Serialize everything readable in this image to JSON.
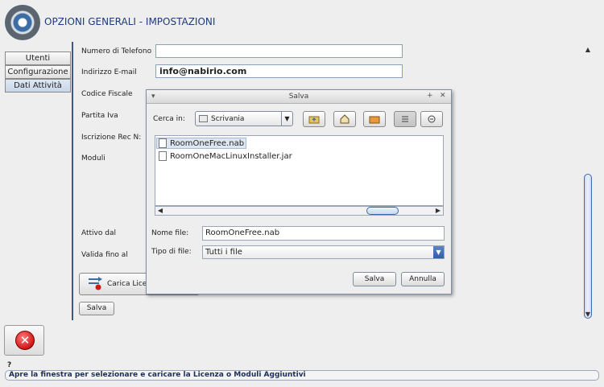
{
  "app": {
    "title": "OPZIONI GENERALI - IMPOSTAZIONI",
    "logo_icon": "gear-cd-icon"
  },
  "sidebar": {
    "tabs": [
      {
        "label": "Utenti"
      },
      {
        "label": "Configurazione"
      },
      {
        "label": "Dati Attività"
      }
    ]
  },
  "form": {
    "fields": [
      {
        "label": "Numero di Telefono",
        "value": ""
      },
      {
        "label": "Indirizzo E-mail",
        "value": "info@nabirio.com"
      },
      {
        "label": "Codice Fiscale",
        "value": ""
      },
      {
        "label": "Partita Iva",
        "value": ""
      },
      {
        "label": "Iscrizione Rec N:",
        "value": ""
      },
      {
        "label": "Moduli",
        "value": ""
      },
      {
        "label": "Attivo dal",
        "value": ""
      },
      {
        "label": "Valida fino al",
        "value": ""
      }
    ],
    "carica_label": "Carica Lice",
    "salva_label": "Salva"
  },
  "exit_icon": "close-x-icon",
  "help_mark": "?",
  "status": "Apre la finestra per selezionare e caricare la Licenza o Moduli Aggiuntivi",
  "dialog": {
    "title": "Salva",
    "lookin_label": "Cerca in:",
    "lookin_value": "Scrivania",
    "nav_buttons": [
      "up-folder-icon",
      "home-icon",
      "new-folder-icon",
      "list-view-icon",
      "details-view-icon"
    ],
    "files": [
      {
        "name": "RoomOneFree.nab",
        "selected": true
      },
      {
        "name": "RoomOneMacLinuxInstaller.jar",
        "selected": false
      }
    ],
    "filename_label": "Nome file:",
    "filename_value": "RoomOneFree.nab",
    "filetype_label": "Tipo di file:",
    "filetype_value": "Tutti i file",
    "save_button": "Salva",
    "cancel_button": "Annulla",
    "titlebar_left": "▾",
    "titlebar_right": [
      "+",
      "✕"
    ]
  },
  "colors": {
    "title_text": "#1d3b7a",
    "accent": "#3b5a8c",
    "exit_red": "#d01818"
  }
}
